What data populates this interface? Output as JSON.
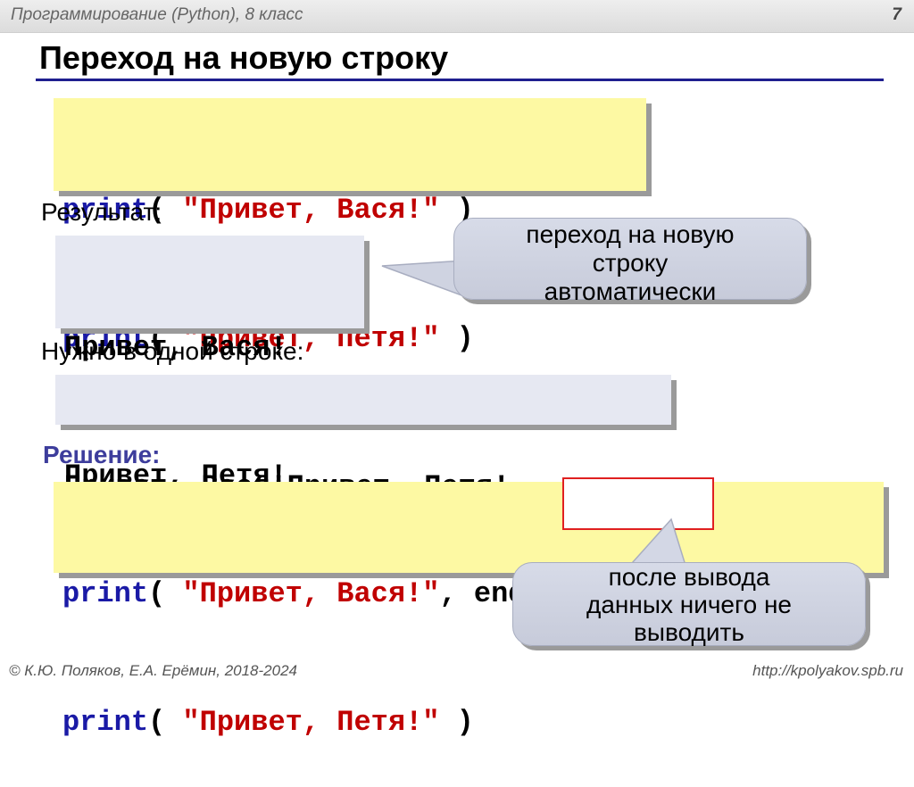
{
  "header": {
    "course": "Программирование (Python), 8 класс",
    "page_number": "7"
  },
  "title": "Переход на новую строку",
  "code1": {
    "line1": {
      "kw": "print",
      "open": "( ",
      "str": "\"Привет, Вася!\"",
      "close": " )"
    },
    "line2": {
      "kw": "print",
      "open": "( ",
      "str": "\"Привет, Петя!\"",
      "close": " )"
    }
  },
  "result_label": "Результат:",
  "output1": {
    "line1": "Привет, Вася!",
    "line2": "Привет, Петя!"
  },
  "callout1": {
    "line1": "переход на новую",
    "line2": "строку",
    "line3": "автоматически"
  },
  "need_label": "Нужно в одной строке:",
  "output2": {
    "line1": "Привет, Вася!Привет, Петя!"
  },
  "solution_label": "Решение:",
  "code2": {
    "line1": {
      "kw": "print",
      "open": "( ",
      "str": "\"Привет, Вася!\"",
      "sep": ", ",
      "end_kw": "end=",
      "end_val": "\"\"",
      "close": " )"
    },
    "line2": {
      "kw": "print",
      "open": "( ",
      "str": "\"Привет, Петя!\"",
      "close": " )"
    }
  },
  "callout2": {
    "line1": "после вывода",
    "line2": "данных ничего не",
    "line3": "выводить"
  },
  "footer": {
    "left": "© К.Ю. Поляков, Е.А. Ерёмин, 2018-2024",
    "right": "http://kpolyakov.spb.ru"
  },
  "colors": {
    "keyword": "#1a1aa6",
    "string": "#c00000",
    "code_bg": "#fdf9a3",
    "output_bg": "#e6e8f2",
    "title_rule": "#1f1f8f",
    "highlight_border": "#e02020"
  }
}
